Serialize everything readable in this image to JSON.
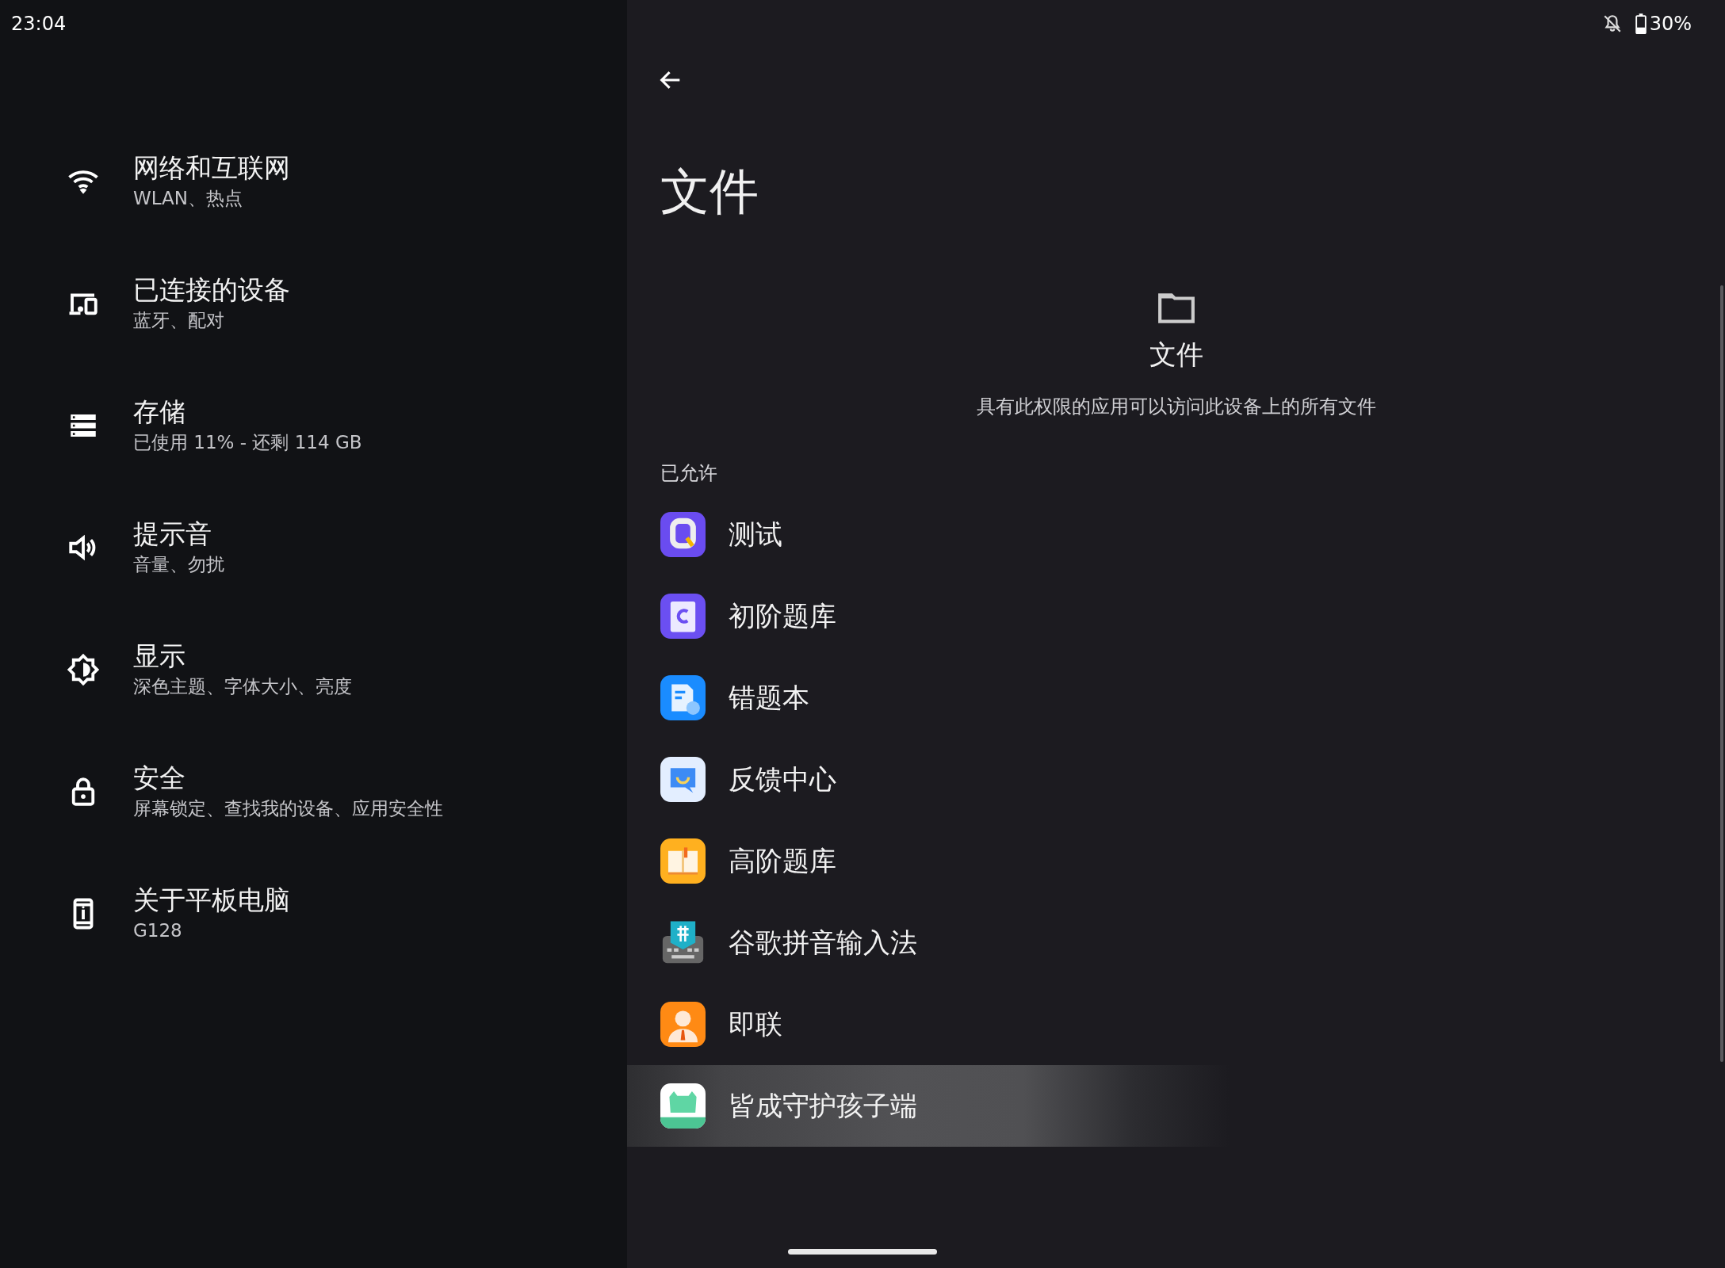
{
  "status_bar": {
    "time": "23:04",
    "battery": "30%"
  },
  "settings_menu": [
    {
      "title": "网络和互联网",
      "subtitle": "WLAN、热点"
    },
    {
      "title": "已连接的设备",
      "subtitle": "蓝牙、配对"
    },
    {
      "title": "存储",
      "subtitle": "已使用 11% - 还剩 114 GB"
    },
    {
      "title": "提示音",
      "subtitle": "音量、勿扰"
    },
    {
      "title": "显示",
      "subtitle": "深色主题、字体大小、亮度"
    },
    {
      "title": "安全",
      "subtitle": "屏幕锁定、查找我的设备、应用安全性"
    },
    {
      "title": "关于平板电脑",
      "subtitle": "G128"
    }
  ],
  "page": {
    "title": "文件",
    "header_label": "文件",
    "description": "具有此权限的应用可以访问此设备上的所有文件",
    "section": "已允许",
    "apps": [
      {
        "name": "测试",
        "pressed": false
      },
      {
        "name": "初阶题库",
        "pressed": false
      },
      {
        "name": "错题本",
        "pressed": false
      },
      {
        "name": "反馈中心",
        "pressed": false
      },
      {
        "name": "高阶题库",
        "pressed": false
      },
      {
        "name": "谷歌拼音输入法",
        "pressed": false
      },
      {
        "name": "即联",
        "pressed": false
      },
      {
        "name": "皆成守护孩子端",
        "pressed": true
      }
    ]
  }
}
